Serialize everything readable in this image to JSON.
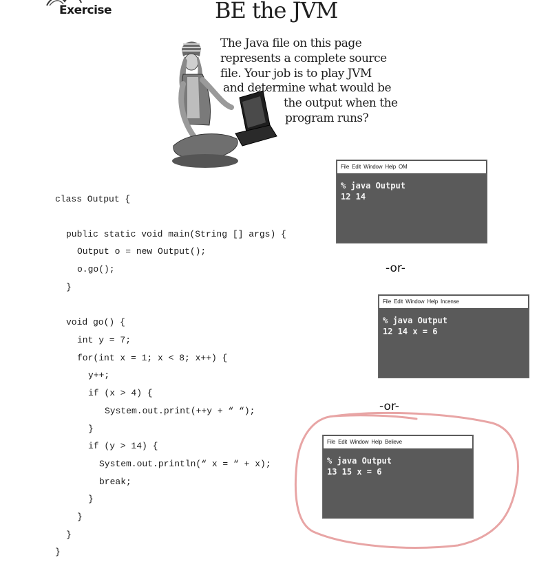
{
  "header": {
    "badge_label": "Exercise",
    "title": "BE the JVM"
  },
  "intro": {
    "lines": [
      "The Java file on this page",
      "represents a complete source",
      "file.  Your job is to play JVM",
      "and determine what would be",
      "the output when the",
      "program runs?"
    ]
  },
  "code": {
    "lines": [
      "class Output {",
      "public static void main(String [] args) {",
      "Output o = new Output();",
      "o.go();",
      "}",
      "void go() {",
      "int y = 7;",
      "for(int x = 1; x < 8; x++) {",
      "y++;",
      "if (x > 4) {",
      "System.out.print(++y + “ “);",
      "}",
      "if (y > 14) {",
      "System.out.println(“ x = “ + x);",
      "break;",
      "}",
      "}",
      "}",
      "}"
    ]
  },
  "terminals": [
    {
      "menu": [
        "File",
        "Edit",
        "Window",
        "Help",
        "OM"
      ],
      "command": "% java Output",
      "output": "12 14"
    },
    {
      "menu": [
        "File",
        "Edit",
        "Window",
        "Help",
        "Incense"
      ],
      "command": "% java Output",
      "output": "12 14 x = 6"
    },
    {
      "menu": [
        "File",
        "Edit",
        "Window",
        "Help",
        "Believe"
      ],
      "command": "% java Output",
      "output": "13 15 x = 6"
    }
  ],
  "separators": [
    "-or-",
    "-or-"
  ],
  "colors": {
    "terminal_bg": "#5a5a5a",
    "terminal_text": "#f4f4f4",
    "circle_mark": "#e8a5a5"
  }
}
